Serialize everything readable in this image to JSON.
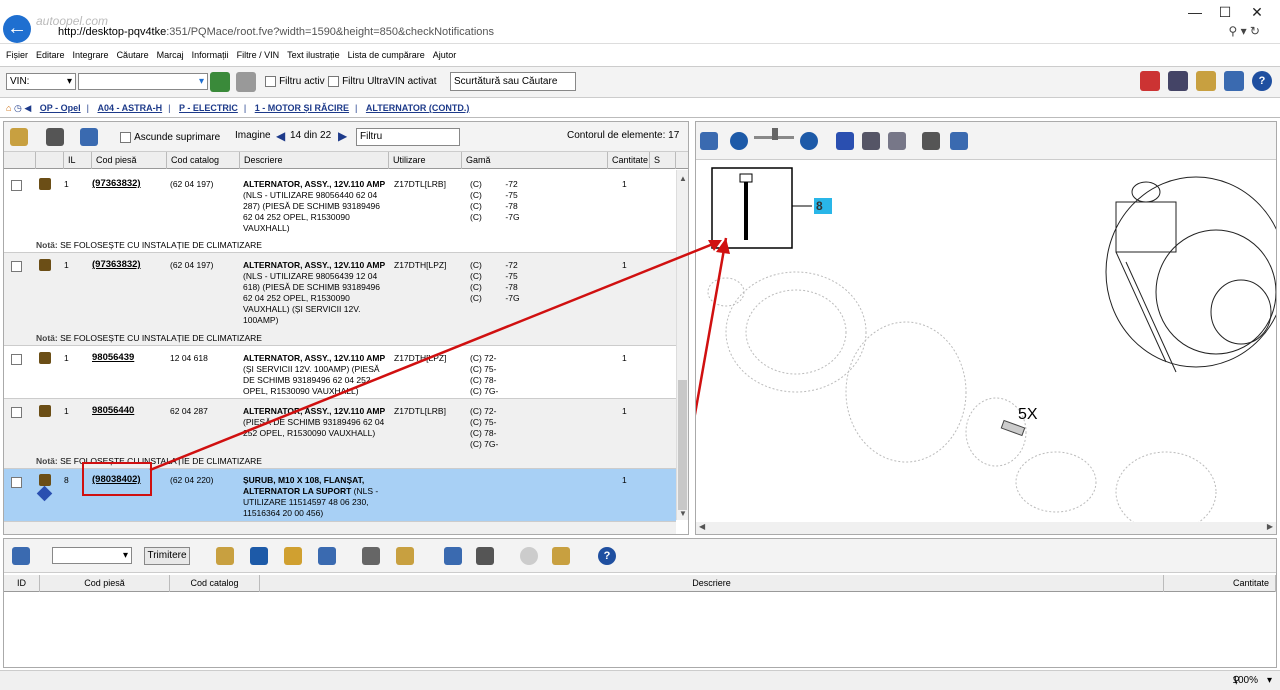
{
  "browser": {
    "url_host": "http://desktop-pqv4tke",
    "url_rest": ":351/PQMace/root.fve?width=1590&height=850&checkNotifications",
    "watermark": "autoopel.com"
  },
  "menu": [
    "Fișier",
    "Editare",
    "Integrare",
    "Căutare",
    "Marcaj",
    "Informații",
    "Filtre / VIN",
    "Text ilustrație",
    "Lista de cumpărare",
    "Ajutor"
  ],
  "toolbar": {
    "vin_label": "VIN:",
    "filter_active": "Filtru activ",
    "filter_ultravin": "Filtru UltraVIN activat",
    "shortcut_placeholder": "Scurtătură sau Căutare"
  },
  "breadcrumbs": [
    "OP - Opel",
    "A04 - ASTRA-H",
    "P - ELECTRIC",
    "1 - MOTOR ȘI RĂCIRE",
    "ALTERNATOR (CONTD.)"
  ],
  "parts_panel": {
    "hide_label": "Ascunde suprimare",
    "image_label": "Imagine",
    "image_position": "14 din 22",
    "filter_value": "Filtru",
    "counter_label": "Contorul de elemente: 17",
    "columns": [
      "IL",
      "Cod piesă",
      "Cod catalog",
      "Descriere",
      "Utilizare",
      "Gamă",
      "Cantitate",
      "S"
    ],
    "rows": [
      {
        "il": "1",
        "code": "(97363832)",
        "catalog": "(62 04 197)",
        "desc_bold": "ALTERNATOR, ASSY., 12V.110 AMP",
        "desc_rest": "(NLS - UTILIZARE 98056440 62 04 287) (PIESĂ DE SCHIMB 93189496 62 04 252 OPEL, R1530090 VAUXHALL)",
        "usage": "Z17DTL[LRB]",
        "range": [
          "(C)          -72",
          "(C)          -75",
          "(C)          -78",
          "(C)          -7G"
        ],
        "qty": "1",
        "note": "SE FOLOSEȘTE CU INSTALAȚIE DE CLIMATIZARE"
      },
      {
        "il": "1",
        "code": "(97363832)",
        "catalog": "(62 04 197)",
        "desc_bold": "ALTERNATOR, ASSY., 12V.110 AMP",
        "desc_rest": "(NLS - UTILIZARE 98056439 12 04 618) (PIESĂ DE SCHIMB 93189496 62 04 252 OPEL, R1530090 VAUXHALL) (ȘI SERVICII 12V. 100AMP)",
        "usage": "Z17DTH[LPZ]",
        "range": [
          "(C)          -72",
          "(C)          -75",
          "(C)          -78",
          "(C)          -7G"
        ],
        "qty": "1",
        "note": "SE FOLOSEȘTE CU INSTALAȚIE DE CLIMATIZARE"
      },
      {
        "il": "1",
        "code": "98056439",
        "catalog": "12 04 618",
        "desc_bold": "ALTERNATOR, ASSY., 12V.110 AMP",
        "desc_rest": "(ȘI SERVICII 12V. 100AMP) (PIESĂ DE SCHIMB 93189496 62 04 252 OPEL, R1530090 VAUXHALL)",
        "usage": "Z17DTH[LPZ]",
        "range": [
          "(C) 72-",
          "(C) 75-",
          "(C) 78-",
          "(C) 7G-"
        ],
        "qty": "1",
        "note": ""
      },
      {
        "il": "1",
        "code": "98056440",
        "catalog": "62 04 287",
        "desc_bold": "ALTERNATOR, ASSY., 12V.110 AMP",
        "desc_rest": "(PIESĂ DE SCHIMB 93189496 62 04 252 OPEL, R1530090 VAUXHALL)",
        "usage": "Z17DTL[LRB]",
        "range": [
          "(C) 72-",
          "(C) 75-",
          "(C) 78-",
          "(C) 7G-"
        ],
        "qty": "1",
        "note": "SE FOLOSEȘTE CU INSTALAȚIE DE CLIMATIZARE"
      },
      {
        "il": "8",
        "code": "(98038402)",
        "catalog": "(62 04 220)",
        "desc_bold": "ȘURUB, M10 X 108, FLANȘAT, ALTERNATOR LA SUPORT",
        "desc_rest": "(NLS - UTILIZARE 11514597 48 06 230, 11516364 20 00 456)",
        "usage": "",
        "range": [],
        "qty": "1",
        "note": ""
      }
    ],
    "note_prefix": "Notă:"
  },
  "diagram": {
    "callout": "8",
    "label_5x": "5X"
  },
  "shopping": {
    "send_label": "Trimitere",
    "columns": [
      "ID",
      "Cod piesă",
      "Cod catalog",
      "Descriere",
      "Cantitate"
    ]
  },
  "status": {
    "zoom": "100%"
  }
}
